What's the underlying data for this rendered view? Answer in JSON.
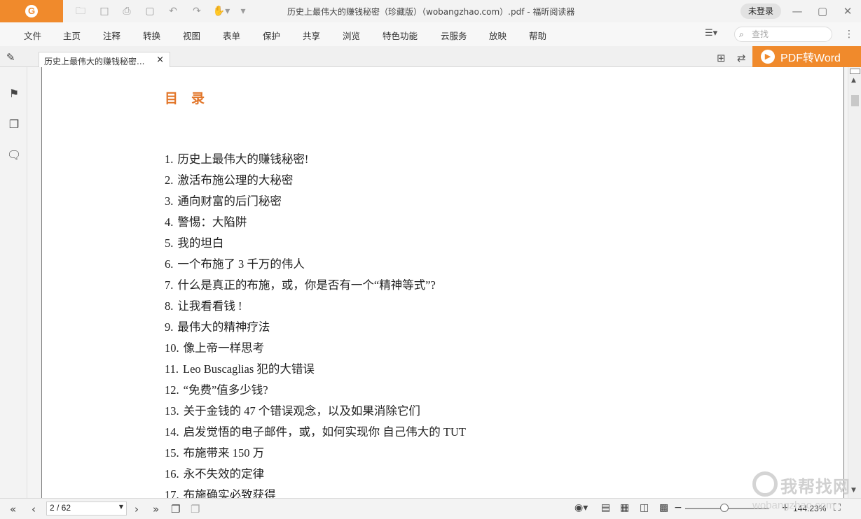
{
  "window": {
    "title": "历史上最伟大的赚钱秘密（珍藏版）（wobangzhao.com）.pdf - 福昕阅读器",
    "login": "未登录"
  },
  "menu": {
    "items": [
      "文件",
      "主页",
      "注释",
      "转换",
      "视图",
      "表单",
      "保护",
      "共享",
      "浏览",
      "特色功能",
      "云服务",
      "放映",
      "帮助"
    ],
    "search_placeholder": "查找"
  },
  "tab": {
    "label": "历史上最伟大的赚钱秘密...",
    "close": "×"
  },
  "promo": {
    "label": "PDF转Word"
  },
  "document": {
    "heading": "目　录",
    "toc": [
      {
        "num": "1.",
        "text": "历史上最伟大的赚钱秘密!"
      },
      {
        "num": "2.",
        "text": "激活布施公理的大秘密"
      },
      {
        "num": "3.",
        "text": "通向财富的后门秘密"
      },
      {
        "num": "4.",
        "text": "警惕：大陷阱"
      },
      {
        "num": "5.",
        "text": "我的坦白"
      },
      {
        "num": "6.",
        "text": "一个布施了 3 千万的伟人"
      },
      {
        "num": "7.",
        "text": "什么是真正的布施，或，你是否有一个“精神等式”?"
      },
      {
        "num": "8.",
        "text": "让我看看钱 !"
      },
      {
        "num": "9.",
        "text": "最伟大的精神疗法"
      },
      {
        "num": "10.",
        "text": "像上帝一样思考"
      },
      {
        "num": "11.",
        "text": "Leo Buscaglias  犯的大错误"
      },
      {
        "num": "12.",
        "text": "“免费”值多少钱?"
      },
      {
        "num": "13.",
        "text": "关于金钱的 47 个错误观念，以及如果消除它们"
      },
      {
        "num": "14.",
        "text": "启发觉悟的电子邮件，或，如何实现你  自己伟大的  TUT"
      },
      {
        "num": "15.",
        "text": "布施带来 150 万"
      },
      {
        "num": "16.",
        "text": "永不失效的定律"
      },
      {
        "num": "17.",
        "text": "布施确实必致获得"
      }
    ]
  },
  "status": {
    "page": "2 / 62",
    "zoom": "144.23%",
    "zoom_level_fraction": 0.47
  },
  "watermark": {
    "text": "我帮找网",
    "url": "wobangzhao.com"
  },
  "colors": {
    "accent": "#f08a2c",
    "heading": "#e2762a"
  }
}
